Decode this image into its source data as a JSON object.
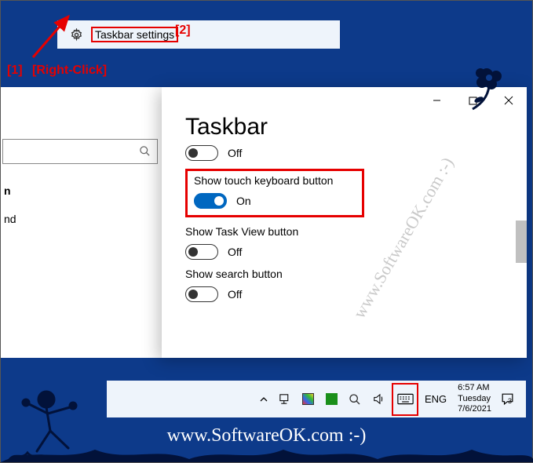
{
  "contextMenu": {
    "label": "Taskbar settings"
  },
  "annotations": {
    "num1": "[1]",
    "rightClick": "[Right-Click]",
    "num2": "[2]"
  },
  "backPanel": {
    "item1": "n",
    "item2": "nd"
  },
  "settingsWindow": {
    "title": "Taskbar",
    "optTopState": "Off",
    "optTouch": {
      "label": "Show touch keyboard button",
      "state": "On"
    },
    "optTaskView": {
      "label": "Show Task View button",
      "state": "Off"
    },
    "optSearch": {
      "label": "Show search button",
      "state": "Off"
    }
  },
  "taskbar": {
    "lang": "ENG",
    "time": "6:57 AM",
    "day": "Tuesday",
    "date": "7/6/2021",
    "notifCount": "3"
  },
  "watermark": "www.SoftwareOK.com :-)",
  "footer": "www.SoftwareOK.com :-)"
}
